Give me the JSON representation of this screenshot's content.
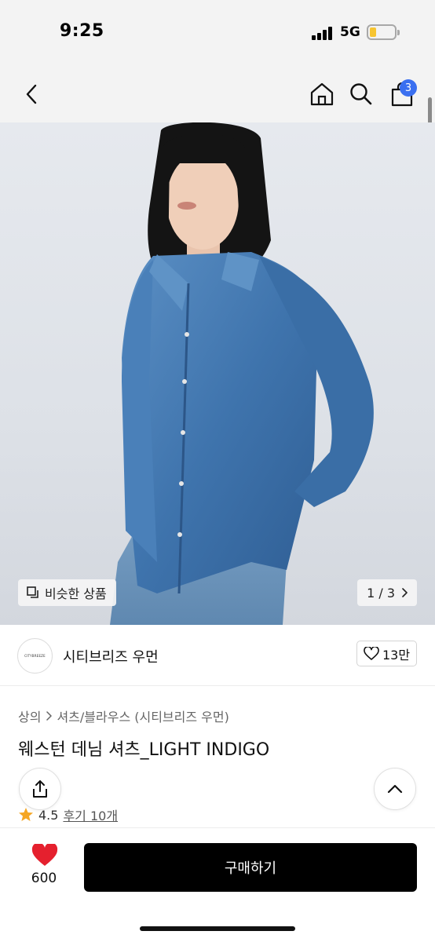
{
  "status_bar": {
    "time": "9:25",
    "network": "5G"
  },
  "nav": {
    "cart_count": "3"
  },
  "hero": {
    "similar_label": "비슷한 상품",
    "page_indicator": "1 / 3"
  },
  "brand": {
    "logo_text": "CITYBREEZE",
    "name": "시티브리즈 우먼",
    "like_count": "13만"
  },
  "product": {
    "breadcrumb": [
      "상의",
      "셔츠/블라우스 (시티브리즈 우먼)"
    ],
    "title": "웨스턴 데님 셔츠_LIGHT INDIGO",
    "rating": "4.5",
    "reviews": "후기 10개"
  },
  "bottom_bar": {
    "wish_count": "600",
    "buy_label": "구매하기"
  },
  "colors": {
    "accent_badge": "#3a6ff0",
    "heart": "#e5202e",
    "star": "#f5a623",
    "buy_button": "#000000"
  }
}
